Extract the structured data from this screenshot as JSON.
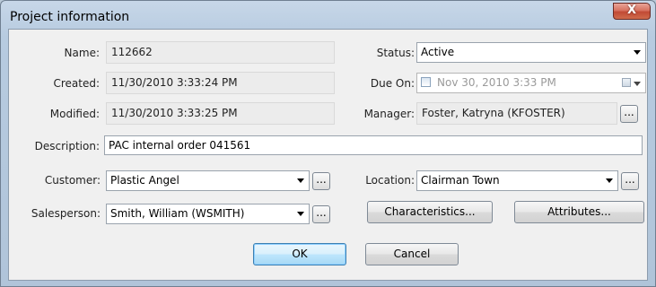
{
  "window": {
    "title": "Project information",
    "close_label": "X"
  },
  "fields": {
    "name": {
      "label": "Name:",
      "value": "112662"
    },
    "created": {
      "label": "Created:",
      "value": "11/30/2010 3:33:24 PM"
    },
    "modified": {
      "label": "Modified:",
      "value": "11/30/2010 3:33:25 PM"
    },
    "status": {
      "label": "Status:",
      "value": "Active"
    },
    "due_on": {
      "label": "Due On:",
      "value": "Nov 30, 2010  3:33 PM",
      "checked": false
    },
    "manager": {
      "label": "Manager:",
      "value": "Foster, Katryna (KFOSTER)"
    },
    "description": {
      "label": "Description:",
      "value": "PAC internal order 041561"
    },
    "customer": {
      "label": "Customer:",
      "value": "Plastic Angel"
    },
    "location": {
      "label": "Location:",
      "value": "Clairman Town"
    },
    "salesperson": {
      "label": "Salesperson:",
      "value": "Smith, William (WSMITH)"
    }
  },
  "buttons": {
    "browse": "...",
    "characteristics": "Characteristics...",
    "attributes": "Attributes...",
    "ok": "OK",
    "cancel": "Cancel"
  }
}
